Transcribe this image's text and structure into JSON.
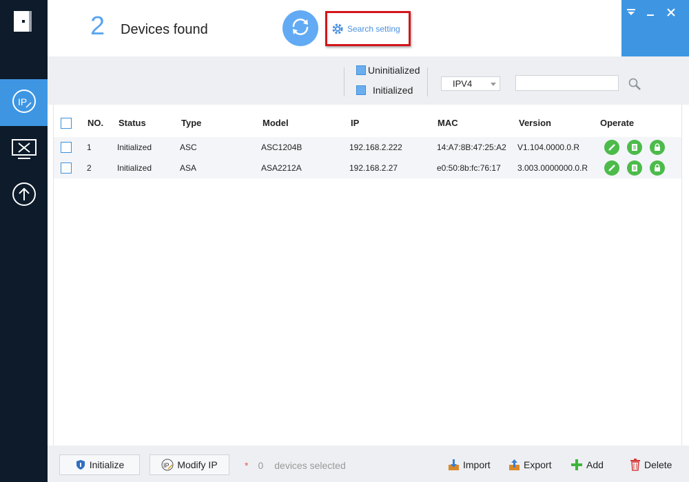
{
  "header": {
    "count": "2",
    "found_label": "Devices found",
    "search_setting_label": "Search setting"
  },
  "filters": {
    "uninitialized_label": "Uninitialized",
    "initialized_label": "Initialized",
    "ip_version": "IPV4",
    "search_value": ""
  },
  "table": {
    "columns": {
      "no": "NO.",
      "status": "Status",
      "type": "Type",
      "model": "Model",
      "ip": "IP",
      "mac": "MAC",
      "version": "Version",
      "operate": "Operate"
    },
    "rows": [
      {
        "no": "1",
        "status": "Initialized",
        "type": "ASC",
        "model": "ASC1204B",
        "ip": "192.168.2.222",
        "mac": "14:A7:8B:47:25:A2",
        "version": "V1.104.0000.0.R"
      },
      {
        "no": "2",
        "status": "Initialized",
        "type": "ASA",
        "model": "ASA2212A",
        "ip": "192.168.2.27",
        "mac": "e0:50:8b:fc:76:17",
        "version": "3.003.0000000.0.R"
      }
    ]
  },
  "footer": {
    "initialize_label": "Initialize",
    "modify_ip_label": "Modify IP",
    "selected_star": "*",
    "selected_count": "0",
    "selected_label": "devices selected",
    "import_label": "Import",
    "export_label": "Export",
    "add_label": "Add",
    "delete_label": "Delete"
  },
  "colors": {
    "accent": "#3e96e3",
    "sidebar_bg": "#0d1b2a",
    "highlight_border": "#d4141b",
    "operate_green": "#4cbb4a"
  },
  "icons": [
    "logout-icon",
    "ip-icon",
    "tools-icon",
    "upgrade-icon",
    "refresh-icon",
    "gear-icon",
    "menu-icon",
    "minimize-icon",
    "close-icon",
    "search-icon",
    "edit-icon",
    "web-icon",
    "password-icon",
    "shield-icon",
    "import-icon",
    "export-icon",
    "add-icon",
    "delete-icon"
  ]
}
